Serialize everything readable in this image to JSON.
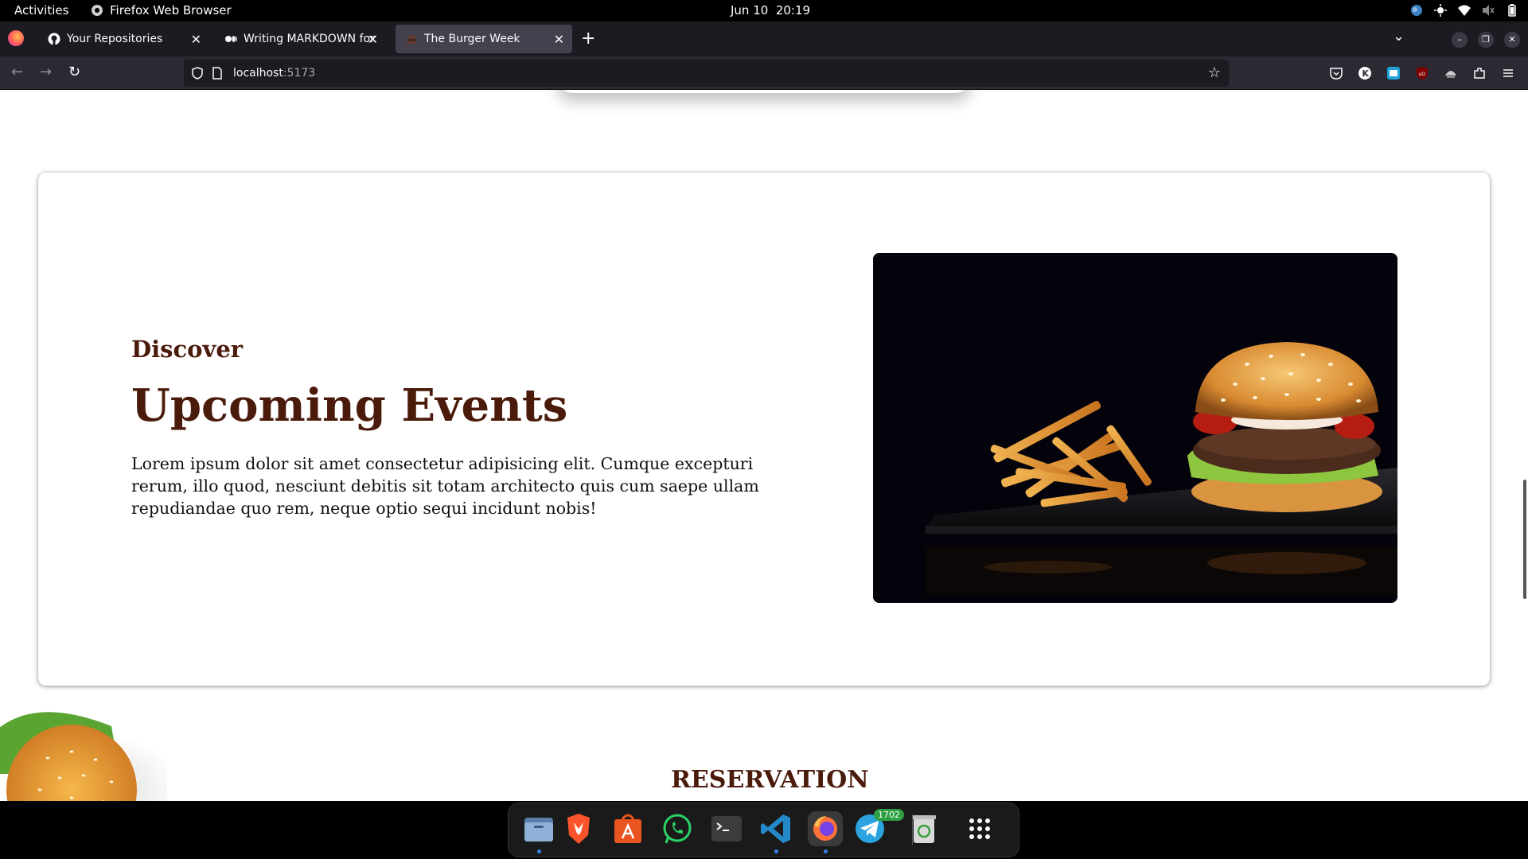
{
  "system": {
    "activities": "Activities",
    "app_name": "Firefox Web Browser",
    "date": "Jun 10",
    "time": "20:19"
  },
  "tabs": [
    {
      "title": "Your Repositories",
      "icon": "github-icon",
      "active": false
    },
    {
      "title": "Writing MARKDOWN for yo",
      "icon": "medium-icon",
      "active": false
    },
    {
      "title": "The Burger Week",
      "icon": "burger-favicon-icon",
      "active": true
    }
  ],
  "url": {
    "host": "localhost",
    "port": ":5173"
  },
  "page": {
    "eyebrow": "Discover",
    "heading": "Upcoming Events",
    "body": "Lorem ipsum dolor sit amet consectetur adipisicing elit. Cumque excepturi rerum, illo quod, nesciunt debitis sit totam architecto quis cum saepe ullam repudiandae quo rem, neque optio sequi incidunt nobis!",
    "next_section": "RESERVATION"
  },
  "dock": {
    "apps": [
      "files-icon",
      "brave-icon",
      "app-center-icon",
      "whatsapp-icon",
      "terminal-icon",
      "vscode-icon",
      "firefox-icon",
      "telegram-icon",
      "trash-icon",
      "app-grid-icon"
    ],
    "telegram_badge": "1702"
  },
  "colors": {
    "heading": "#4a1a0b",
    "tab_active": "#42414d",
    "toolbar": "#2b2a33"
  }
}
